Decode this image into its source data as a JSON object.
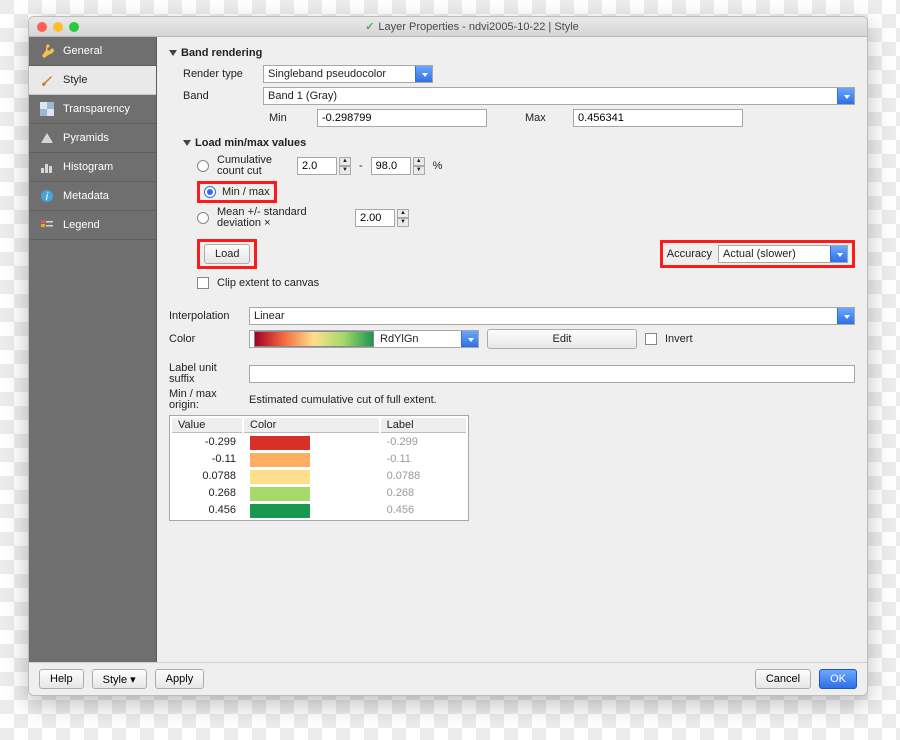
{
  "window": {
    "title": "Layer Properties - ndvi2005-10-22 | Style"
  },
  "sidebar": {
    "items": [
      {
        "label": "General"
      },
      {
        "label": "Style"
      },
      {
        "label": "Transparency"
      },
      {
        "label": "Pyramids"
      },
      {
        "label": "Histogram"
      },
      {
        "label": "Metadata"
      },
      {
        "label": "Legend"
      }
    ],
    "selected_index": 1
  },
  "sections": {
    "band_rendering": "Band rendering",
    "load_minmax": "Load min/max values"
  },
  "render": {
    "type_label": "Render type",
    "type_value": "Singleband pseudocolor",
    "band_label": "Band",
    "band_value": "Band 1 (Gray)",
    "min_label": "Min",
    "min_value": "-0.298799",
    "max_label": "Max",
    "max_value": "0.456341"
  },
  "minmax": {
    "cum_label": "Cumulative count cut",
    "cum_lo": "2.0",
    "cum_hi": "98.0",
    "cum_suffix": "%",
    "minmax_label": "Min / max",
    "stddev_label": "Mean +/- standard deviation ×",
    "stddev_value": "2.00",
    "load_btn": "Load",
    "accuracy_label": "Accuracy",
    "accuracy_value": "Actual (slower)",
    "clip_label": "Clip extent to canvas",
    "selected": "minmax"
  },
  "interp": {
    "label": "Interpolation",
    "value": "Linear"
  },
  "color": {
    "label": "Color",
    "ramp_name": "RdYlGn",
    "edit": "Edit",
    "invert": "Invert"
  },
  "label_unit": {
    "label": "Label unit suffix",
    "value": ""
  },
  "origin": {
    "label": "Min / max origin:",
    "value": "Estimated cumulative cut of full extent."
  },
  "table": {
    "headers": {
      "value": "Value",
      "color": "Color",
      "label": "Label"
    },
    "rows": [
      {
        "value": "-0.299",
        "color": "#d73027",
        "label": "-0.299"
      },
      {
        "value": "-0.11",
        "color": "#fdae61",
        "label": "-0.11"
      },
      {
        "value": "0.0788",
        "color": "#fee08b",
        "label": "0.0788"
      },
      {
        "value": "0.268",
        "color": "#a6d96a",
        "label": "0.268"
      },
      {
        "value": "0.456",
        "color": "#1a9850",
        "label": "0.456"
      }
    ]
  },
  "footer": {
    "help": "Help",
    "style": "Style ▾",
    "apply": "Apply",
    "cancel": "Cancel",
    "ok": "OK"
  }
}
